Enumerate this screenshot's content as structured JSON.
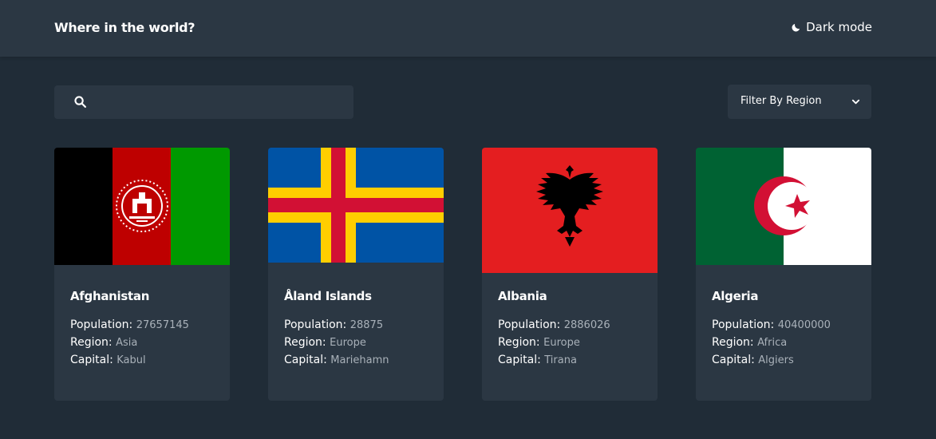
{
  "header": {
    "title": "Where in the world?",
    "mode_label": "Dark mode"
  },
  "search": {
    "placeholder": "",
    "value": ""
  },
  "filter": {
    "label": "Filter By Region"
  },
  "field_labels": {
    "population": "Population:",
    "region": "Region:",
    "capital": "Capital:"
  },
  "countries": [
    {
      "name": "Afghanistan",
      "population": "27657145",
      "region": "Asia",
      "capital": "Kabul"
    },
    {
      "name": "Åland Islands",
      "population": "28875",
      "region": "Europe",
      "capital": "Mariehamn"
    },
    {
      "name": "Albania",
      "population": "2886026",
      "region": "Europe",
      "capital": "Tirana"
    },
    {
      "name": "Algeria",
      "population": "40400000",
      "region": "Africa",
      "capital": "Algiers"
    }
  ],
  "colors": {
    "background": "#202c37",
    "element": "#2b3743",
    "text": "#ffffff",
    "muted": "#a9b1b9"
  },
  "icons": {
    "mode": "moon-icon",
    "search": "search-icon",
    "filter": "chevron-down-icon"
  }
}
